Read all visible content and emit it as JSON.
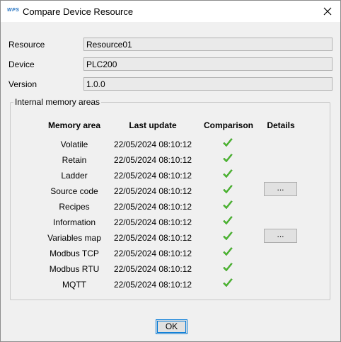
{
  "window": {
    "title": "Compare Device Resource",
    "icon_text": "WPS"
  },
  "fields": {
    "resource_label": "Resource",
    "resource_value": "Resource01",
    "device_label": "Device",
    "device_value": "PLC200",
    "version_label": "Version",
    "version_value": "1.0.0"
  },
  "group": {
    "title": "Internal memory areas",
    "headers": {
      "memory_area": "Memory area",
      "last_update": "Last update",
      "comparison": "Comparison",
      "details": "Details"
    },
    "rows": [
      {
        "area": "Volatile",
        "last_update": "22/05/2024 08:10:12",
        "comparison": "check-icon",
        "details": ""
      },
      {
        "area": "Retain",
        "last_update": "22/05/2024 08:10:12",
        "comparison": "check-icon",
        "details": ""
      },
      {
        "area": "Ladder",
        "last_update": "22/05/2024 08:10:12",
        "comparison": "check-icon",
        "details": ""
      },
      {
        "area": "Source code",
        "last_update": "22/05/2024 08:10:12",
        "comparison": "check-icon",
        "details": "..."
      },
      {
        "area": "Recipes",
        "last_update": "22/05/2024 08:10:12",
        "comparison": "check-icon",
        "details": ""
      },
      {
        "area": "Information",
        "last_update": "22/05/2024 08:10:12",
        "comparison": "check-icon",
        "details": ""
      },
      {
        "area": "Variables map",
        "last_update": "22/05/2024 08:10:12",
        "comparison": "check-icon",
        "details": "..."
      },
      {
        "area": "Modbus TCP",
        "last_update": "22/05/2024 08:10:12",
        "comparison": "check-icon",
        "details": ""
      },
      {
        "area": "Modbus RTU",
        "last_update": "22/05/2024 08:10:12",
        "comparison": "check-icon",
        "details": ""
      },
      {
        "area": "MQTT",
        "last_update": "22/05/2024 08:10:12",
        "comparison": "check-icon",
        "details": ""
      }
    ]
  },
  "footer": {
    "ok_label": "OK"
  },
  "colors": {
    "check": "#4cbb2f",
    "accent": "#0078d7"
  }
}
